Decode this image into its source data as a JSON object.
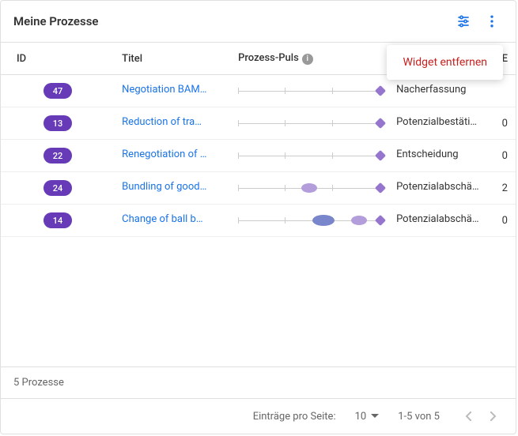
{
  "header": {
    "title": "Meine Prozesse"
  },
  "menu": {
    "remove": "Widget entfernen"
  },
  "columns": {
    "id": "ID",
    "titel": "Titel",
    "puls": "Prozess-Puls",
    "status": "",
    "e": "E"
  },
  "rows": [
    {
      "id": "47",
      "titel": "Negotiation BAM…",
      "status": "Nacherfassung",
      "extra": ""
    },
    {
      "id": "13",
      "titel": "Reduction of tra…",
      "status": "Potenzialbestäti…",
      "extra": "0"
    },
    {
      "id": "22",
      "titel": "Renegotiation of …",
      "status": "Entscheidung",
      "extra": "0"
    },
    {
      "id": "24",
      "titel": "Bundling of good…",
      "status": "Potenzialabschä…",
      "extra": "2"
    },
    {
      "id": "14",
      "titel": "Change of ball b…",
      "status": "Potenzialabschä…",
      "extra": "0"
    }
  ],
  "footer": {
    "count": "5 Prozesse"
  },
  "paginator": {
    "label": "Einträge pro Seite:",
    "size": "10",
    "range": "1-5 von 5"
  }
}
